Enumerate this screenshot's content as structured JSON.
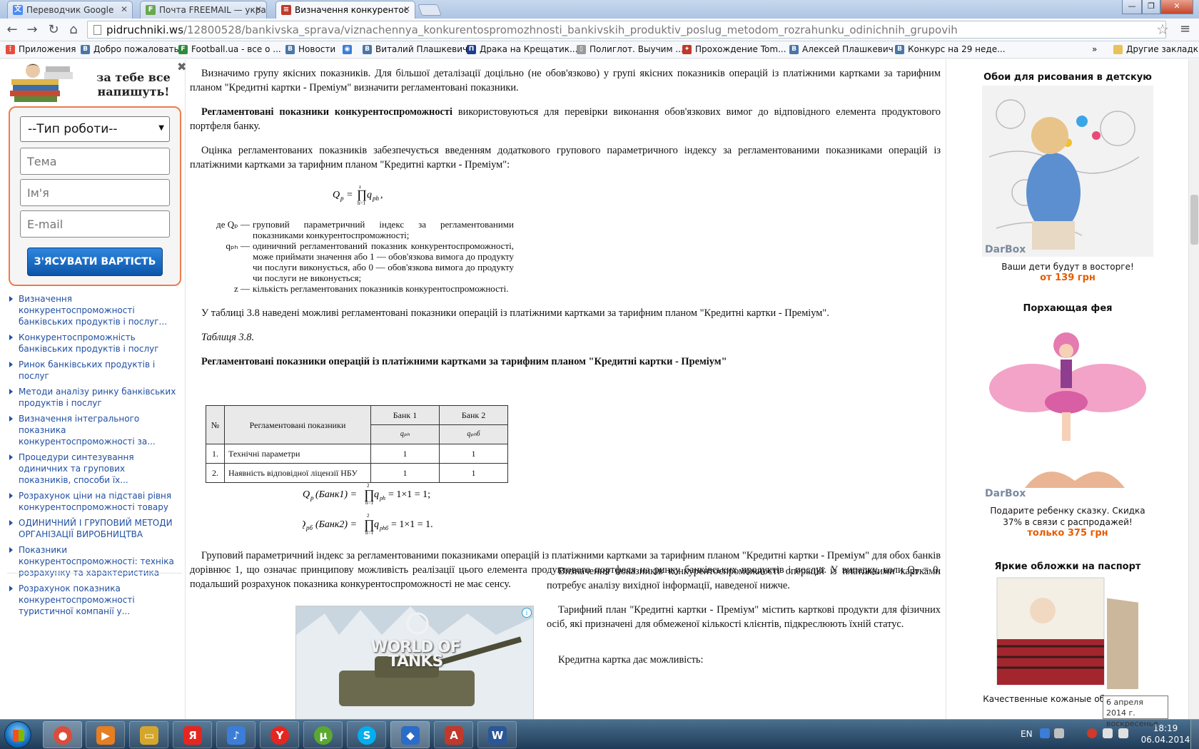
{
  "browser": {
    "tabs": [
      {
        "title": "Переводчик Google",
        "icon": "google-translate-icon",
        "color": "#4a8af4"
      },
      {
        "title": "Почта FREEMAIL — укра",
        "icon": "freemail-icon",
        "color": "#6aa84f"
      },
      {
        "title": "Визначення конкурентос",
        "icon": "pidruchniki-icon",
        "color": "#c0392b"
      }
    ],
    "url_host": "pidruchniki.ws",
    "url_path": "/12800528/bankivska_sprava/viznachennya_konkurentospromozhnosti_bankivskih_produktiv_poslug_metodom_rozrahunku_odinichnih_grupovih",
    "bookmarks": [
      {
        "label": "Приложения",
        "icon": "apps-icon",
        "color": "#e74c3c"
      },
      {
        "label": "Добро пожаловать",
        "icon": "vk-icon",
        "color": "#4a76a8"
      },
      {
        "label": "Football.ua - все о ...",
        "icon": "football-icon",
        "color": "#2e8b3a"
      },
      {
        "label": "Новости",
        "icon": "news-icon",
        "color": "#4a76a8"
      },
      {
        "label": "",
        "icon": "globe-icon",
        "color": "#3b7dd8"
      },
      {
        "label": "Виталий Плашкевич",
        "icon": "vk-icon",
        "color": "#4a76a8"
      },
      {
        "label": "Драка на Крещатик...",
        "icon": "bookmark-icon",
        "color": "#1b3d8f"
      },
      {
        "label": "Полиглот. Выучим ...",
        "icon": "page-icon",
        "color": "#999999"
      },
      {
        "label": "Прохождение Tom...",
        "icon": "game-icon",
        "color": "#c0392b"
      },
      {
        "label": "Алексей Плашкевич",
        "icon": "vk-icon",
        "color": "#4a76a8"
      },
      {
        "label": "Конкурс на 29 неде...",
        "icon": "vk-icon",
        "color": "#4a76a8"
      }
    ],
    "overflow_label": "»",
    "other_bookmarks": "Другие закладки"
  },
  "left_sidebar": {
    "promo_title": "за тебе все напишуть!",
    "form": {
      "select_value": "--Тип роботи--",
      "topic_placeholder": "Тема",
      "name_placeholder": "Ім'я",
      "email_placeholder": "E-mail",
      "submit_label": "З'ЯСУВАТИ ВАРТІСТЬ"
    },
    "related_links": [
      "Визначення конкурентоспроможності банківських продуктів і послуг...",
      "Конкурентоспроможність банківських продуктів і послуг",
      "Ринок банківських продуктів і послуг",
      "Методи аналізу ринку банківських продуктів і послуг",
      "Визначення інтегрального показника конкурентоспроможності за...",
      "Процедури синтезування одиничних та групових показників, способи їх...",
      "Розрахунок ціни на підставі рівня конкурентоспроможності товару",
      "ОДИНИЧНИЙ І ГРУПОВИЙ МЕТОДИ ОРГАНІЗАЦІЇ ВИРОБНИЦТВА",
      "Показники конкурентоспроможності: техніка розрахунку та характеристика",
      "Розрахунок показника конкурентоспроможності туристичної компанії у..."
    ]
  },
  "article": {
    "p1": "Визначимо групу якісних показників. Для більшої деталізації доцільно (не обов'язково) у групі якісних показників операцій із платіжними картками за тарифним планом \"Кредитні картки - Преміум\" визначити регламентовані показники.",
    "p2_bold": "Регламентовані показники конкурентоспроможності",
    "p2_rest": " використовуються для перевірки виконання обов'язкових вимог до відповідного елемента продуктового портфеля банку.",
    "p3": "Оцінка регламентованих показників забезпечується введенням додаткового групового параметричного індексу за регламентованими показниками операцій із платіжними картками за тарифним планом \"Кредитні картки - Преміум\":",
    "formula_main": "Q",
    "legend": [
      {
        "sym": "де Qₚ —",
        "desc": "груповий параметричний індекс за регламентованими показниками конкурентоспроможності;"
      },
      {
        "sym": "qₚₕ —",
        "desc": "одиничний регламентований показник конкурентоспроможності, може приймати значення або 1 — обов'язкова вимога до продукту чи послуги виконується, або 0 — обов'язкова вимога до продукту чи послуги не виконується;"
      },
      {
        "sym": "z —",
        "desc": "кількість регламентованих показників конкурентоспроможності."
      }
    ],
    "p4": "У таблиці 3.8 наведені можливі регламентовані показники операцій із платіжними картками за тарифним планом \"Кредитні картки - Преміум\".",
    "table_caption": "Таблиця 3.8.",
    "table_title": "Регламентовані показники операцій із платіжними картками за тарифним планом \"Кредитні картки - Преміум\"",
    "table": {
      "headers": [
        "№",
        "Регламентовані показники",
        "Банк 1",
        "Банк 2"
      ],
      "subheaders": [
        "qₚₕ",
        "qₚₕб"
      ],
      "rows": [
        [
          "1.",
          "Технічні параметри",
          "1",
          "1"
        ],
        [
          "2.",
          "Наявність відповідної ліцензії НБУ",
          "1",
          "1"
        ]
      ]
    },
    "calc1": "(Банк1) =",
    "calc1_result": "= 1×1 = 1;",
    "calc2": "(Банк2) =",
    "calc2_result": "= 1×1 = 1.",
    "p5": "Груповий параметричний індекс за регламентованими показниками операцій із платіжними картками за тарифним планом \"Кредитні картки - Преміум\" для обох банків дорівнює 1, що означає принципову можливість реалізації цього елемента продуктового портфеля на ринку банківських продуктів і послуг. У випадку, коли Qₚ = 0, подальший розрахунок показника конкурентоспроможності не має сенсу.",
    "p6": "Визначення показників конкурентоспроможності операцій із платіжними картками потребує аналізу вихідної інформації, наведеної нижче.",
    "p7": "Тарифний план \"Кредитні картки - Преміум\" містить карткові продукти для фізичних осіб, які призначені для обмеженої кількості клієнтів, підкреслюють їхній статус.",
    "p8": "Кредитна картка дає можливість:",
    "ad_text": "WORLD OF TANKS"
  },
  "right_sidebar": {
    "products": [
      {
        "title": "Обои для рисования в детскую",
        "caption": "Ваши дети будут в восторге!",
        "price": "от 139 грн"
      },
      {
        "title": "Порхающая фея",
        "caption": "Подарите ребенку сказку. Скидка 37% в связи с распродажей!",
        "price": "только 375 грн"
      },
      {
        "title": "Яркие обложки на паспорт",
        "caption": "Качественные кожаные об... паспорт",
        "price": ""
      }
    ],
    "brand": "DarBox"
  },
  "tooltip": {
    "line1": "6 апреля 2014 г.",
    "line2": "воскресенье"
  },
  "taskbar": {
    "lang": "EN",
    "time": "18:19",
    "date": "06.04.2014",
    "apps": [
      {
        "icon": "chrome-icon",
        "color": "#dd4b39"
      },
      {
        "icon": "media-player-icon",
        "color": "#e67e22"
      },
      {
        "icon": "explorer-icon",
        "color": "#d4a72c"
      },
      {
        "icon": "yandex-icon",
        "color": "#e52620"
      },
      {
        "icon": "speaker-icon",
        "color": "#3b7dd8"
      },
      {
        "icon": "yandex-browser-icon",
        "color": "#e52620"
      },
      {
        "icon": "utorrent-icon",
        "color": "#5aa832"
      },
      {
        "icon": "skype-icon",
        "color": "#00aff0"
      },
      {
        "icon": "shield-icon",
        "color": "#2a6cc8"
      },
      {
        "icon": "acrobat-icon",
        "color": "#c0392b"
      },
      {
        "icon": "word-icon",
        "color": "#2b5797"
      }
    ]
  }
}
